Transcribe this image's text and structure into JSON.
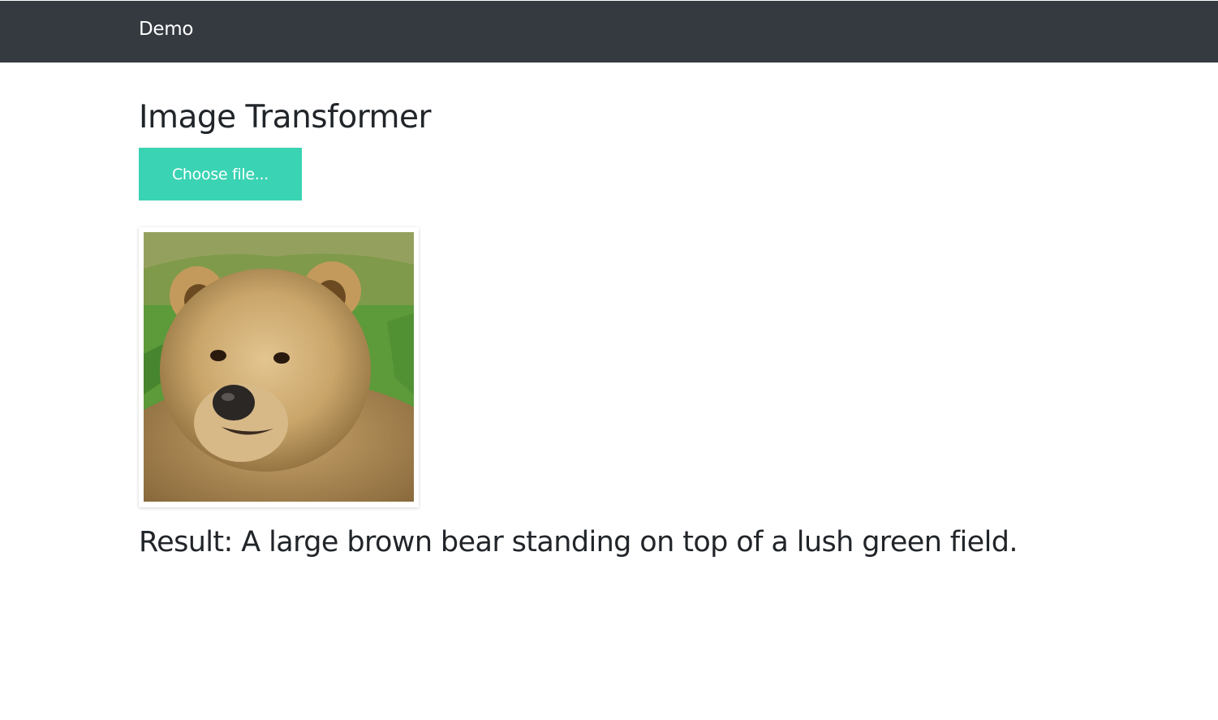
{
  "navbar": {
    "brand": "Demo"
  },
  "main": {
    "title": "Image Transformer",
    "file_button_label": "Choose file...",
    "image_alt": "brown bear on grass",
    "result_text": "Result: A large brown bear standing on top of a lush green field."
  },
  "colors": {
    "navbar": "#343a40",
    "accent": "#3ad3b3",
    "text": "#212529"
  }
}
